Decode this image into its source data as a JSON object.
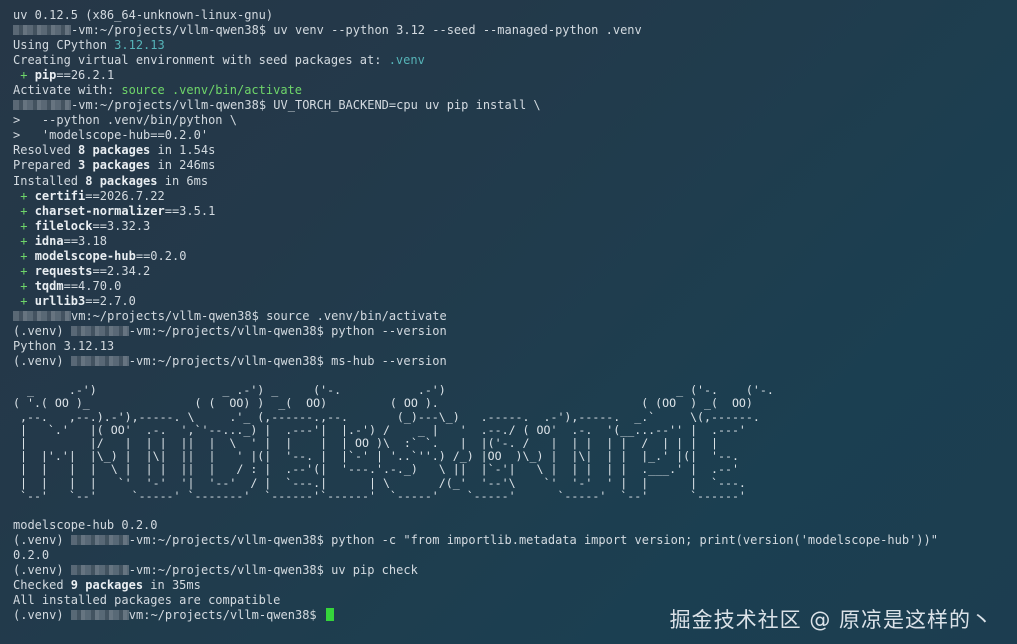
{
  "terminal": {
    "lines": [
      {
        "id": "l0",
        "text": "uv 0.12.5 (x86_64-unknown-linux-gnu)"
      },
      {
        "id": "l1",
        "prompt_path": "-vm:~/projects/vllm-qwen38$",
        "cmd": " uv venv --python 3.12 --seed --managed-python .venv"
      },
      {
        "id": "l2",
        "text": "Using CPython ",
        "value": "3.12.13"
      },
      {
        "id": "l3",
        "text": "Creating virtual environment with seed packages at: ",
        "value": ".venv"
      },
      {
        "id": "l4",
        "plus": " + ",
        "pkg": "pip",
        "ver": "==26.2.1"
      },
      {
        "id": "l5",
        "text": "Activate with: ",
        "value": "source .venv/bin/activate"
      },
      {
        "id": "l6",
        "prompt_path": "-vm:~/projects/vllm-qwen38$",
        "cmd": " UV_TORCH_BACKEND=cpu uv pip install \\"
      },
      {
        "id": "l7",
        "text": ">   --python .venv/bin/python \\"
      },
      {
        "id": "l8",
        "text": ">   'modelscope-hub==0.2.0'"
      },
      {
        "id": "l9",
        "pre": "Resolved ",
        "num": "8 packages",
        "post": " in 1.54s"
      },
      {
        "id": "l10",
        "pre": "Prepared ",
        "num": "3 packages",
        "post": " in 246ms"
      },
      {
        "id": "l11",
        "pre": "Installed ",
        "num": "8 packages",
        "post": " in 6ms"
      }
    ],
    "packages": [
      {
        "pkg": "certifi",
        "ver": "==2026.7.22"
      },
      {
        "pkg": "charset-normalizer",
        "ver": "==3.5.1"
      },
      {
        "pkg": "filelock",
        "ver": "==3.32.3"
      },
      {
        "pkg": "idna",
        "ver": "==3.18"
      },
      {
        "pkg": "modelscope-hub",
        "ver": "==0.2.0"
      },
      {
        "pkg": "requests",
        "ver": "==2.34.2"
      },
      {
        "pkg": "tqdm",
        "ver": "==4.70.0"
      },
      {
        "pkg": "urllib3",
        "ver": "==2.7.0"
      }
    ],
    "plus": " + ",
    "after": [
      {
        "venv": "",
        "prompt_path": "vm:~/projects/vllm-qwen38$",
        "cmd": " source .venv/bin/activate"
      },
      {
        "venv": "(.venv) ",
        "prompt_path": "-vm:~/projects/vllm-qwen38$",
        "cmd": " python --version"
      },
      {
        "text": "Python 3.12.13"
      },
      {
        "venv": "(.venv) ",
        "prompt_path": "-vm:~/projects/vllm-qwen38$",
        "cmd": " ms-hub --version"
      }
    ],
    "ascii_art": "  _     .-')                  _ .-') _     ('-.           .-')                                 _ ('-.    ('-.\n( '.( OO )_               ( (  OO) )  _(  OO)         ( OO ).                             ( (OO  ) _(  OO)\n ,--.   ,--.).-'),-----. \\     .'_ (,------.,--.       (_)---\\_)   .-----.  .-'),-----.  _.`     \\(,------.\n |   `.'   |( OO'  .-.  ',`'--..._) |  .---'|  |.-') /    _ |   '  .--./ ( OO'  .-.  '(__...--'' |  .---'\n |         |/   |  | |  ||  |  \\  ' |  |    |  | OO )\\  :` `.   |  |('-. /   |  | |  | |  /  | | |  |\n |  |'.'|  |\\_) |  |\\|  ||  |   ' |(|  '--. |  |`-' | '..`''.) /_) |OO  )\\_) |  |\\|  | |  |_.' |(|  '--.\n |  |   |  |  \\ |  | |  ||  |   / : |  .--'(|  '---.'.-._)   \\ ||  |`-'|   \\ |  | |  | |  .___.' |  .--'\n |  |   |  |   `'  '-'  '|  '--'  / |  `---.|      | \\       /(_'  '--'\\    `'  '-'  ' |  |      |  `---.\n `--'   `--'     `-----' `-------'  `------'`------'  `-----'    `-----'      `-----'  `--'      `------'",
    "footer": [
      {
        "text": "modelscope-hub 0.2.0"
      },
      {
        "venv": "(.venv) ",
        "prompt_path": "-vm:~/projects/vllm-qwen38$",
        "cmd": " python -c \"from importlib.metadata import version; print(version('modelscope-hub'))\""
      },
      {
        "text": "0.2.0"
      },
      {
        "venv": "(.venv) ",
        "prompt_path": "-vm:~/projects/vllm-qwen38$",
        "cmd": " uv pip check"
      },
      {
        "pre": "Checked ",
        "num": "9 packages",
        "post": " in 35ms"
      },
      {
        "text": "All installed packages are compatible"
      },
      {
        "venv": "(.venv) ",
        "prompt_path": "vm:~/projects/vllm-qwen38$",
        "cmd": " "
      }
    ]
  },
  "watermark": "掘金技术社区 @ 原凉是这样的丶",
  "colors": {
    "green": "#6fd66a",
    "cyan": "#56b4b8",
    "cursor": "#35d43b"
  }
}
